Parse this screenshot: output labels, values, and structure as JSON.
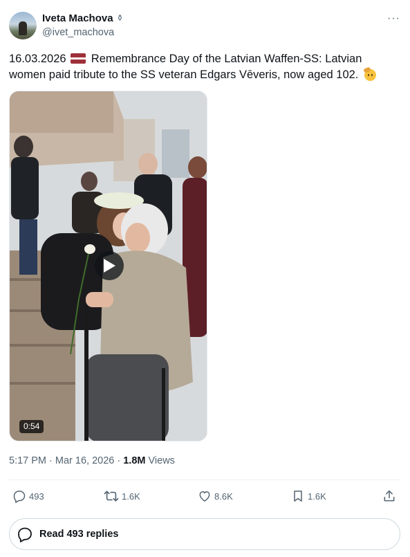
{
  "author": {
    "name": "Iveta Machova",
    "badge": "⚱",
    "handle": "@ivet_machova"
  },
  "more_label": "···",
  "tweet": {
    "date_prefix": "16.03.2026",
    "text": "Remembrance Day of the Latvian Waffen-SS: Latvian women paid tribute to the SS veteran Edgars Vēveris, now aged 102."
  },
  "media": {
    "type": "video",
    "duration": "0:54"
  },
  "meta": {
    "time": "5:17 PM",
    "sep1": " · ",
    "date": "Mar 16, 2026",
    "sep2": " · ",
    "views_count": "1.8M",
    "views_label": "Views"
  },
  "actions": {
    "replies": "493",
    "reposts": "1.6K",
    "likes": "8.6K",
    "bookmarks": "1.6K"
  },
  "read_replies_label": "Read 493 replies",
  "colors": {
    "text": "#0f1419",
    "secondary": "#536471",
    "border": "#cfd9de",
    "flag_red": "#9e3039"
  }
}
